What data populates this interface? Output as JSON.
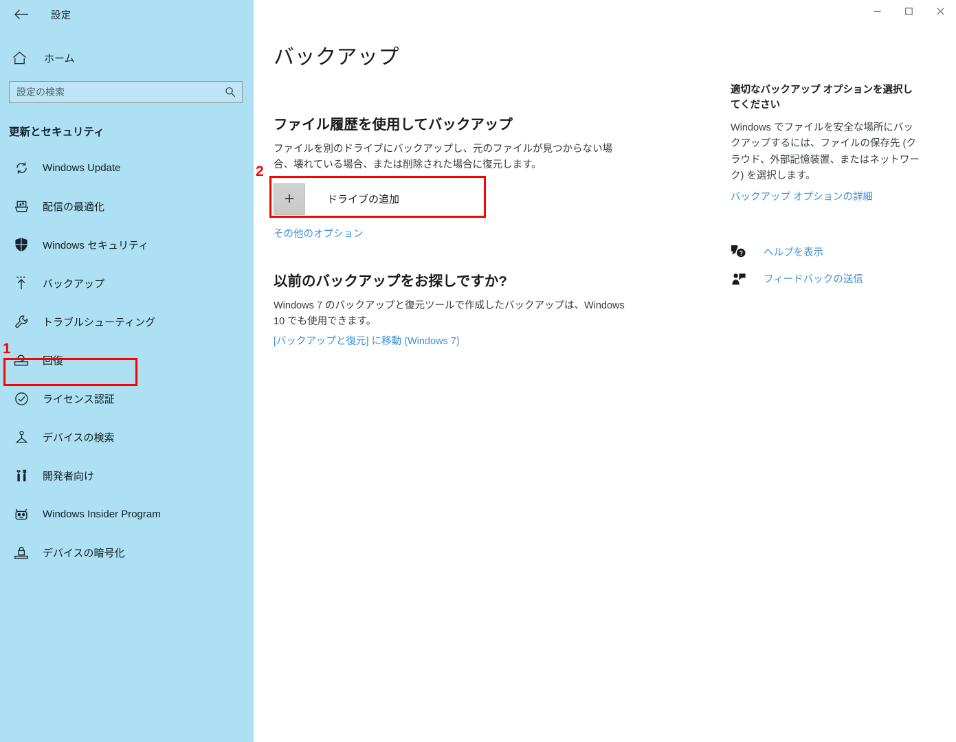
{
  "window": {
    "title": "設定",
    "back_icon": "back-arrow-icon",
    "controls": [
      {
        "name": "minimize-button",
        "glyph": "─"
      },
      {
        "name": "maximize-button",
        "glyph": "□"
      },
      {
        "name": "close-button",
        "glyph": "✕"
      }
    ]
  },
  "sidebar": {
    "home": {
      "label": "ホーム",
      "icon": "home-icon"
    },
    "search": {
      "placeholder": "設定の検索",
      "value": "",
      "icon": "search-icon"
    },
    "section_heading": "更新とセキュリティ",
    "items": [
      {
        "label": "Windows Update",
        "icon": "sync-icon"
      },
      {
        "label": "配信の最適化",
        "icon": "delivery-optimization-icon"
      },
      {
        "label": "Windows セキュリティ",
        "icon": "shield-icon"
      },
      {
        "label": "バックアップ",
        "icon": "upload-arrow-icon"
      },
      {
        "label": "トラブルシューティング",
        "icon": "wrench-icon"
      },
      {
        "label": "回復",
        "icon": "recovery-icon"
      },
      {
        "label": "ライセンス認証",
        "icon": "check-circle-icon"
      },
      {
        "label": "デバイスの検索",
        "icon": "find-device-icon"
      },
      {
        "label": "開発者向け",
        "icon": "developer-tools-icon"
      },
      {
        "label": "Windows Insider Program",
        "icon": "insider-cat-icon"
      },
      {
        "label": "デバイスの暗号化",
        "icon": "device-encryption-lock-icon"
      }
    ]
  },
  "main": {
    "page_title": "バックアップ",
    "file_history": {
      "heading": "ファイル履歴を使用してバックアップ",
      "description": "ファイルを別のドライブにバックアップし、元のファイルが見つからない場合、壊れている場合、または削除された場合に復元します。",
      "add_drive_label": "ドライブの追加",
      "add_drive_icon": "plus-icon",
      "more_options_link": "その他のオプション"
    },
    "older_backup": {
      "heading": "以前のバックアップをお探しですか?",
      "description": "Windows 7 のバックアップと復元ツールで作成したバックアップは、Windows 10 でも使用できます。",
      "link": "[バックアップと復元] に移動 (Windows 7)"
    }
  },
  "rail": {
    "title": "適切なバックアップ オプションを選択してください",
    "body": "Windows でファイルを安全な場所にバックアップするには、ファイルの保存先 (クラウド、外部記憶装置、またはネットワーク) を選択します。",
    "details_link": "バックアップ オプションの詳細",
    "actions": [
      {
        "label": "ヘルプを表示",
        "icon": "help-question-bubble-icon"
      },
      {
        "label": "フィードバックの送信",
        "icon": "feedback-person-icon"
      }
    ]
  },
  "annotations": {
    "badge_1": "1",
    "badge_2": "2",
    "color": "#ff0000"
  },
  "colors": {
    "sidebar_bg": "#ade0f2",
    "main_bg": "#ffffff",
    "link": "#3b91d6",
    "annotation_red": "#ff0000"
  }
}
